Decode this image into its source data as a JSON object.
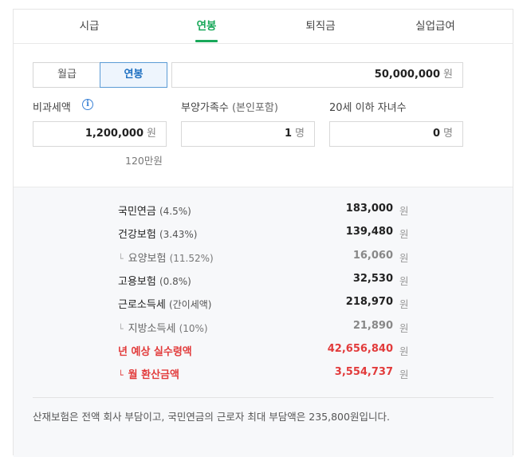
{
  "tabs": [
    {
      "label": "시급"
    },
    {
      "label": "연봉"
    },
    {
      "label": "퇴직금"
    },
    {
      "label": "실업급여"
    }
  ],
  "mode_toggle": {
    "monthly": "월급",
    "annual": "연봉"
  },
  "salary_input": {
    "value": "50,000,000",
    "unit": "원"
  },
  "nontaxable": {
    "label": "비과세액",
    "info_icon": "i",
    "value": "1,200,000",
    "unit": "원",
    "hint": "120만원"
  },
  "dependents": {
    "label": "부양가족수",
    "label_paren": "(본인포함)",
    "value": "1",
    "unit": "명"
  },
  "children": {
    "label": "20세 이하 자녀수",
    "value": "0",
    "unit": "명"
  },
  "results": [
    {
      "name": "국민연금",
      "paren": "(4.5%)",
      "amount": "183,000",
      "unit": "원",
      "sub": false,
      "red": false
    },
    {
      "name": "건강보험",
      "paren": "(3.43%)",
      "amount": "139,480",
      "unit": "원",
      "sub": false,
      "red": false
    },
    {
      "name": "요양보험",
      "paren": "(11.52%)",
      "amount": "16,060",
      "unit": "원",
      "sub": true,
      "red": false
    },
    {
      "name": "고용보험",
      "paren": "(0.8%)",
      "amount": "32,530",
      "unit": "원",
      "sub": false,
      "red": false
    },
    {
      "name": "근로소득세",
      "paren": "(간이세액)",
      "amount": "218,970",
      "unit": "원",
      "sub": false,
      "red": false
    },
    {
      "name": "지방소득세",
      "paren": "(10%)",
      "amount": "21,890",
      "unit": "원",
      "sub": true,
      "red": false
    },
    {
      "name": "년 예상 실수령액",
      "paren": "",
      "amount": "42,656,840",
      "unit": "원",
      "sub": false,
      "red": true
    },
    {
      "name": "월 환산금액",
      "paren": "",
      "amount": "3,554,737",
      "unit": "원",
      "sub": true,
      "red": true
    }
  ],
  "branch_glyph": "└",
  "note": "산재보험은 전액 회사 부담이고, 국민연금의 근로자 최대 부담액은 235,800원입니다.",
  "colors": {
    "accent_green": "#19a85a",
    "accent_blue": "#1d6fc1",
    "highlight_red": "#e23b3b"
  }
}
